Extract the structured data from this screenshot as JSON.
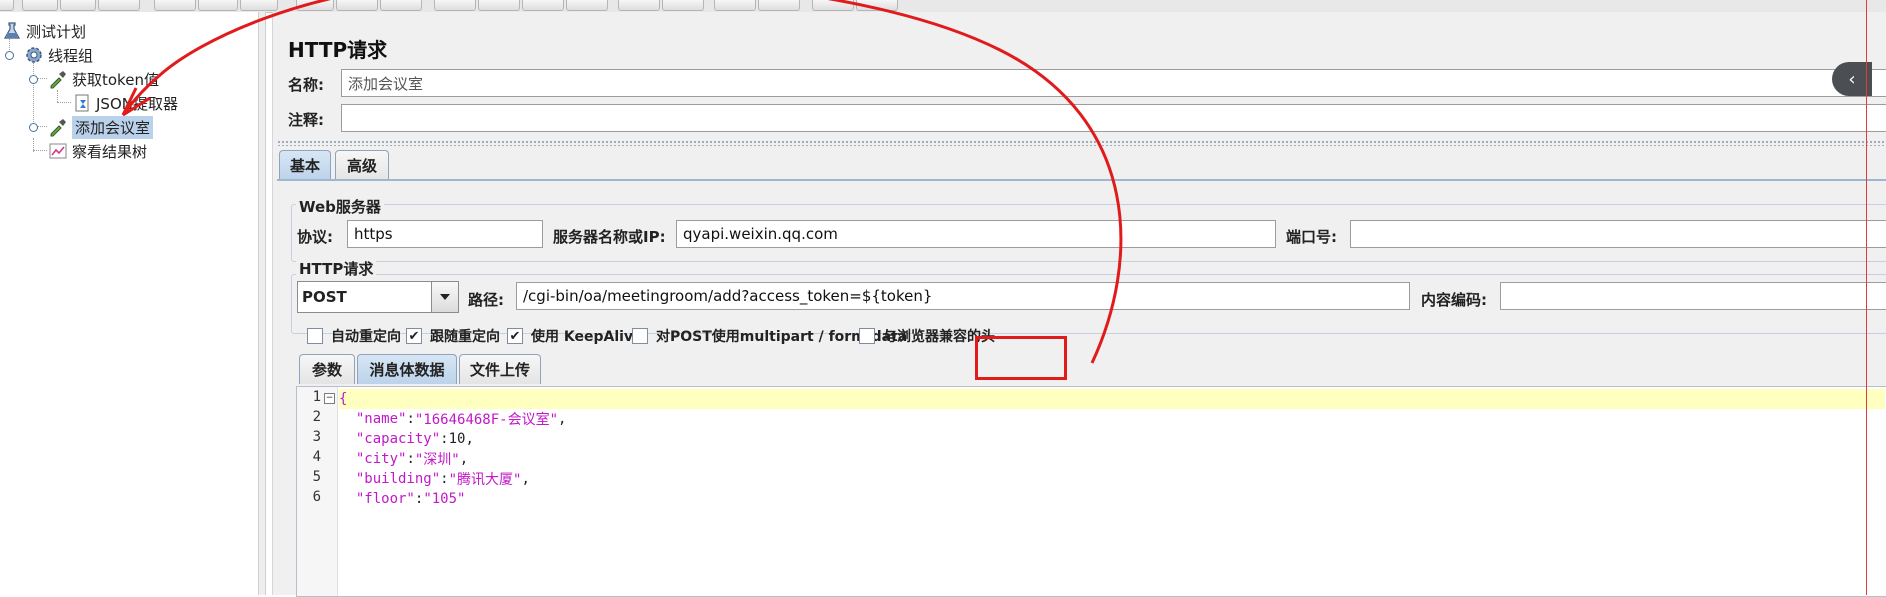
{
  "tree": {
    "items": [
      {
        "label": "测试计划",
        "icon": "flask-icon"
      },
      {
        "label": "线程组",
        "icon": "gear-icon"
      },
      {
        "label": "获取token值",
        "icon": "dropper-icon"
      },
      {
        "label": "JSON提取器",
        "icon": "extractor-icon"
      },
      {
        "label": "添加会议室",
        "icon": "dropper-icon"
      },
      {
        "label": "察看结果树",
        "icon": "chart-icon"
      }
    ],
    "selected_index": 4
  },
  "panel": {
    "title": "HTTP请求",
    "name_label": "名称:",
    "name_value": "添加会议室",
    "comment_label": "注释:",
    "comment_value": ""
  },
  "tabs": {
    "basic": "基本",
    "advanced": "高级",
    "active": "basic"
  },
  "web_server": {
    "group_title": "Web服务器",
    "protocol_label": "协议:",
    "protocol_value": "https",
    "server_label": "服务器名称或IP:",
    "server_value": "qyapi.weixin.qq.com",
    "port_label": "端口号:",
    "port_value": ""
  },
  "http_request": {
    "group_title": "HTTP请求",
    "method_value": "POST",
    "path_label": "路径:",
    "path_value": "/cgi-bin/oa/meetingroom/add?access_token=${token}",
    "encoding_label": "内容编码:",
    "encoding_value": ""
  },
  "options": [
    {
      "label": "自动重定向",
      "checked": false
    },
    {
      "label": "跟随重定向",
      "checked": true
    },
    {
      "label": "使用 KeepAlive",
      "checked": true
    },
    {
      "label": "对POST使用multipart / form-data",
      "checked": false
    },
    {
      "label": "与浏览器兼容的头",
      "checked": false
    }
  ],
  "body_tabs": {
    "params": "参数",
    "body_data": "消息体数据",
    "file_upload": "文件上传",
    "active": "body_data"
  },
  "editor": {
    "line_numbers": [
      "1",
      "2",
      "3",
      "4",
      "5",
      "6"
    ],
    "lines": {
      "l1": "{",
      "l2_key": "\"name\"",
      "l2_val": "\"16646468F-会议室\"",
      "l3_key": "\"capacity\"",
      "l3_val": "10",
      "l4_key": "\"city\"",
      "l4_val": "\"深圳\"",
      "l5_key": "\"building\"",
      "l5_val": "\"腾讯大厦\"",
      "l6_key": "\"floor\"",
      "l6_val": "\"105\""
    },
    "fold_marker": "−"
  },
  "annotations": {
    "highlight_color": "#e11b1b",
    "highlighted_text": "${token}"
  },
  "collapse_handle_glyph": "‹"
}
